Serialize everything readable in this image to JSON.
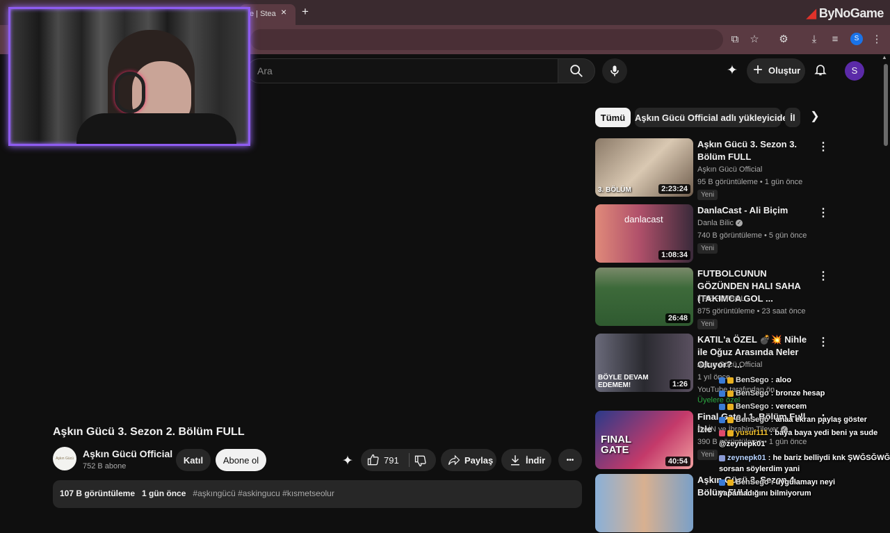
{
  "browser": {
    "tab_title": "e | Stea",
    "close_symbol": "×",
    "new_tab_symbol": "+",
    "brand": "ByNoGame",
    "profile_initial": "S"
  },
  "youtube": {
    "search_placeholder": "Ara",
    "create_label": "Oluştur",
    "avatar_initial": "S"
  },
  "chips": [
    {
      "label": "Tümü",
      "active": true
    },
    {
      "label": "Aşkın Gücü Official adlı yükleyiciden",
      "active": false
    },
    {
      "label": "İl",
      "active": false
    }
  ],
  "recommendations": [
    {
      "title": "Aşkın Gücü 3. Sezon 3. Bölüm FULL",
      "channel": "Aşkın Gücü Official",
      "meta": "95 B görüntüleme • 1 gün önce",
      "badge": "Yeni",
      "duration": "2:23:24",
      "thumb_text": "3. BÖLÜM",
      "verified": false
    },
    {
      "title": "DanlaCast - Ali Biçim",
      "channel": "Danla Bilic",
      "meta": "740 B görüntüleme • 5 gün önce",
      "badge": "Yeni",
      "duration": "1:08:34",
      "thumb_text": "danlacast",
      "verified": true
    },
    {
      "title": "FUTBOLCUNUN GÖZÜNDEN HALI SAHA (TAKIMCA GOL ...",
      "channel": "THE FUTBOL",
      "meta": "875 görüntüleme • 23 saat önce",
      "badge": "Yeni",
      "duration": "26:48",
      "thumb_text": "",
      "verified": false
    },
    {
      "title": "KATIL'a ÖZEL 💣💥 Nihle ile Oğuz Arasında Neler Oluyor? ...",
      "channel": "Aşkın Gücü Official",
      "meta": "1 yıl önce",
      "badge": "YouTube tarafından ön",
      "members_label": "Üyelere özel",
      "duration": "1:26",
      "thumb_text": "BÖYLE DEVAM EDEMEM!",
      "verified": false
    },
    {
      "title": "Final Gate | 1. Bölüm Full İzle",
      "channel": "GAİN ve İbrahim Tilever",
      "meta": "390 B görüntüleme • 1 gün önce",
      "badge": "Yeni",
      "duration": "40:54",
      "thumb_text": "FINAL GATE",
      "verified": true
    },
    {
      "title": "Aşkın Gücü 3. Sezon 4. Bölüm FULL",
      "channel": "",
      "meta": "",
      "badge": "",
      "duration": "",
      "thumb_text": "",
      "verified": false
    }
  ],
  "video": {
    "title": "Aşkın Gücü 3. Sezon 2. Bölüm FULL",
    "channel": "Aşkın Gücü Official",
    "subscribers": "752 B abone",
    "join_label": "Katıl",
    "subscribe_label": "Abone ol",
    "likes": "791",
    "share_label": "Paylaş",
    "download_label": "İndir",
    "more_symbol": "•••",
    "views": "107 B görüntüleme",
    "date": "1 gün önce",
    "hashtags": "#aşkıngücü #askingucu #kısmetseolur",
    "avatar_text": "Aşkın Gücü"
  },
  "chat": [
    {
      "user": "BenSego",
      "message": ": aloo"
    },
    {
      "user": "BenSego",
      "message": ": bronze hesap"
    },
    {
      "user": "BenSego",
      "message": ": verecem"
    },
    {
      "user": "BenSego",
      "message": ": anaa ekran paylaş göster"
    },
    {
      "user": "yusuf111",
      "message": ": baya baya yedi beni ya sude"
    },
    {
      "user": "",
      "message": "@zeynepk01"
    },
    {
      "user": "zeynepk01",
      "message": ": he bariz belliydi knk ŞWĞSĞWĞ"
    },
    {
      "user": "",
      "message": "sorsan söylerdim yani"
    },
    {
      "user": "BenSego",
      "message": ": uygulamayı neyi"
    },
    {
      "user": "",
      "message": "yapamadığını bilmiyorum"
    }
  ]
}
